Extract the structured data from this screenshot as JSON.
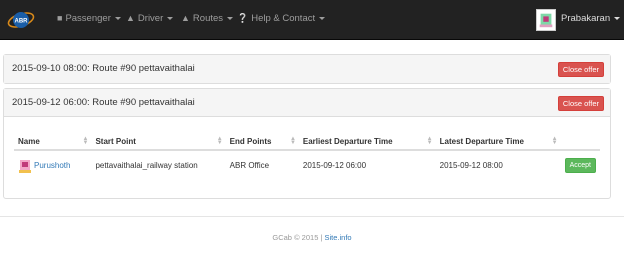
{
  "nav": {
    "brand": "ABR",
    "items": [
      {
        "label": "Passenger",
        "icon": "user-icon"
      },
      {
        "label": "Driver",
        "icon": "road-icon"
      },
      {
        "label": "Routes",
        "icon": "road-icon"
      },
      {
        "label": "Help & Contact",
        "icon": "question-icon"
      }
    ],
    "user": {
      "name": "Prabakaran"
    }
  },
  "offers": [
    {
      "title": "2015-09-10 08:00: Route #90 pettavaithalai",
      "close_label": "Close offer"
    },
    {
      "title": "2015-09-12 06:00: Route #90 pettavaithalai",
      "close_label": "Close offer",
      "table": {
        "columns": [
          "Name",
          "Start Point",
          "End Points",
          "Earliest Departure Time",
          "Latest Departure Time"
        ],
        "rows": [
          {
            "name": "Purushoth",
            "start": "pettavaithalai_railway station",
            "end": "ABR Office",
            "earliest": "2015-09-12 06:00",
            "latest": "2015-09-12 08:00",
            "action": "Accept"
          }
        ]
      }
    }
  ],
  "footer": {
    "copyright": "GCab © 2015 |",
    "link": "Site.info"
  },
  "colors": {
    "navbar": "#222222",
    "danger": "#d9534f",
    "success": "#5cb85c",
    "link": "#337ab7"
  }
}
